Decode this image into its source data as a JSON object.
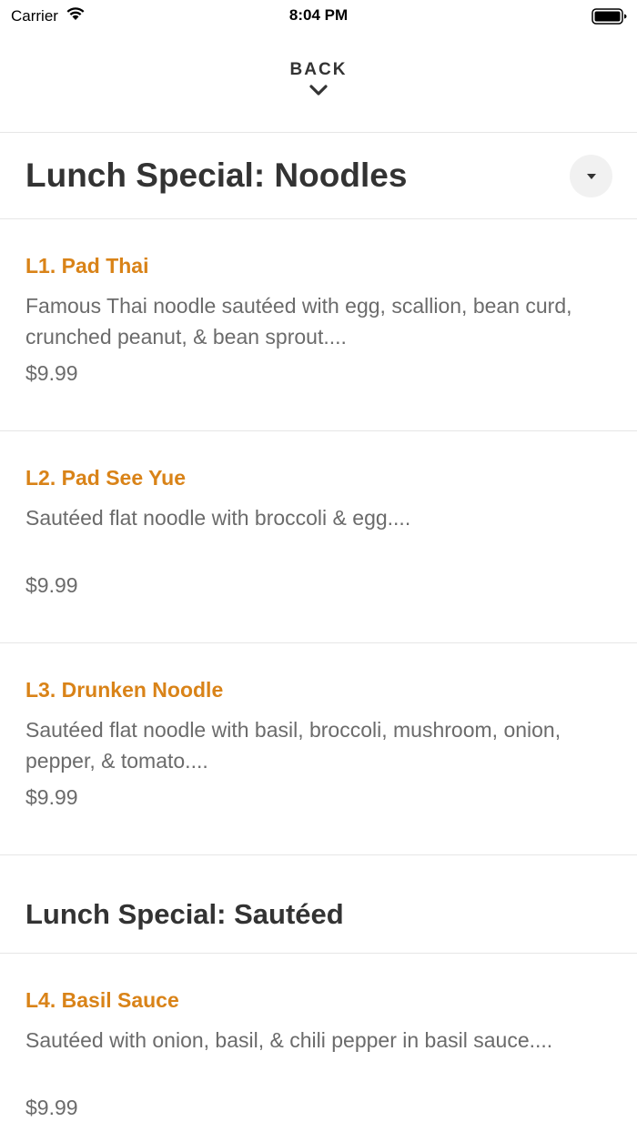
{
  "status_bar": {
    "carrier": "Carrier",
    "time": "8:04 PM"
  },
  "nav": {
    "back_label": "BACK"
  },
  "sections": [
    {
      "title": "Lunch Special: Noodles",
      "items": [
        {
          "name": "L1. Pad Thai",
          "description": "Famous Thai noodle sautéed with egg, scallion, bean curd, crunched peanut, & bean sprout....",
          "price": "$9.99"
        },
        {
          "name": "L2. Pad See Yue",
          "description": "Sautéed flat noodle with broccoli & egg....",
          "price": "$9.99"
        },
        {
          "name": "L3. Drunken Noodle",
          "description": "Sautéed flat noodle with basil, broccoli, mushroom, onion, pepper, & tomato....",
          "price": "$9.99"
        }
      ]
    },
    {
      "title": "Lunch Special: Sautéed",
      "items": [
        {
          "name": "L4. Basil Sauce",
          "description": "Sautéed with onion, basil, & chili pepper in basil sauce....",
          "price": "$9.99"
        }
      ]
    }
  ],
  "colors": {
    "accent": "#d98318",
    "text": "#333333",
    "muted": "#6b6b6b",
    "divider": "#e6e6e6"
  },
  "icons": {
    "wifi": "wifi-icon",
    "battery": "battery-icon",
    "back_chevron": "chevron-down-icon",
    "section_toggle": "caret-down-icon"
  }
}
